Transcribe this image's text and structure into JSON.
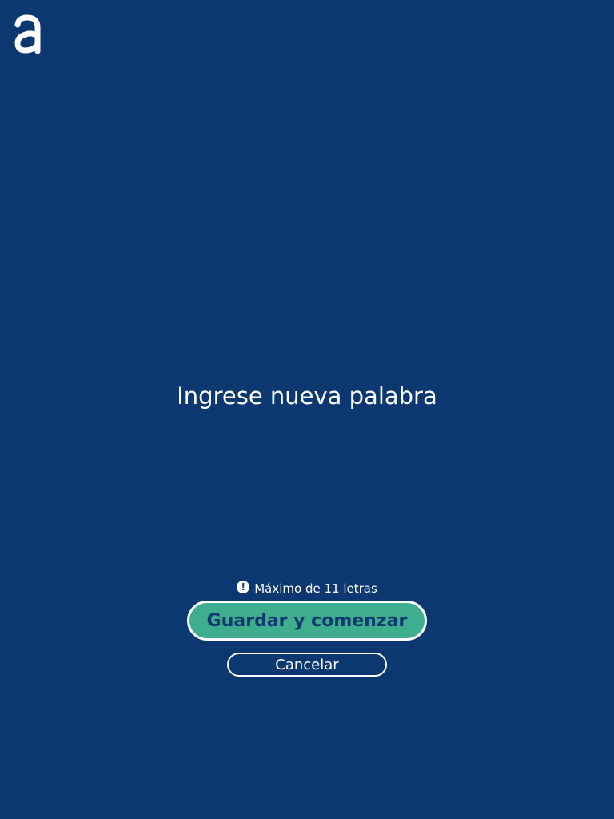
{
  "app": {
    "logo_icon": "a-logo-icon"
  },
  "word_entry": {
    "placeholder": "Ingrese nueva palabra",
    "value": ""
  },
  "hint": {
    "icon": "exclamation-circle-icon",
    "text": "Máximo de 11 letras"
  },
  "actions": {
    "save_label": "Guardar y comenzar",
    "cancel_label": "Cancelar"
  },
  "colors": {
    "background": "#0b3870",
    "accent": "#3fae8e",
    "text": "#ffffff"
  }
}
